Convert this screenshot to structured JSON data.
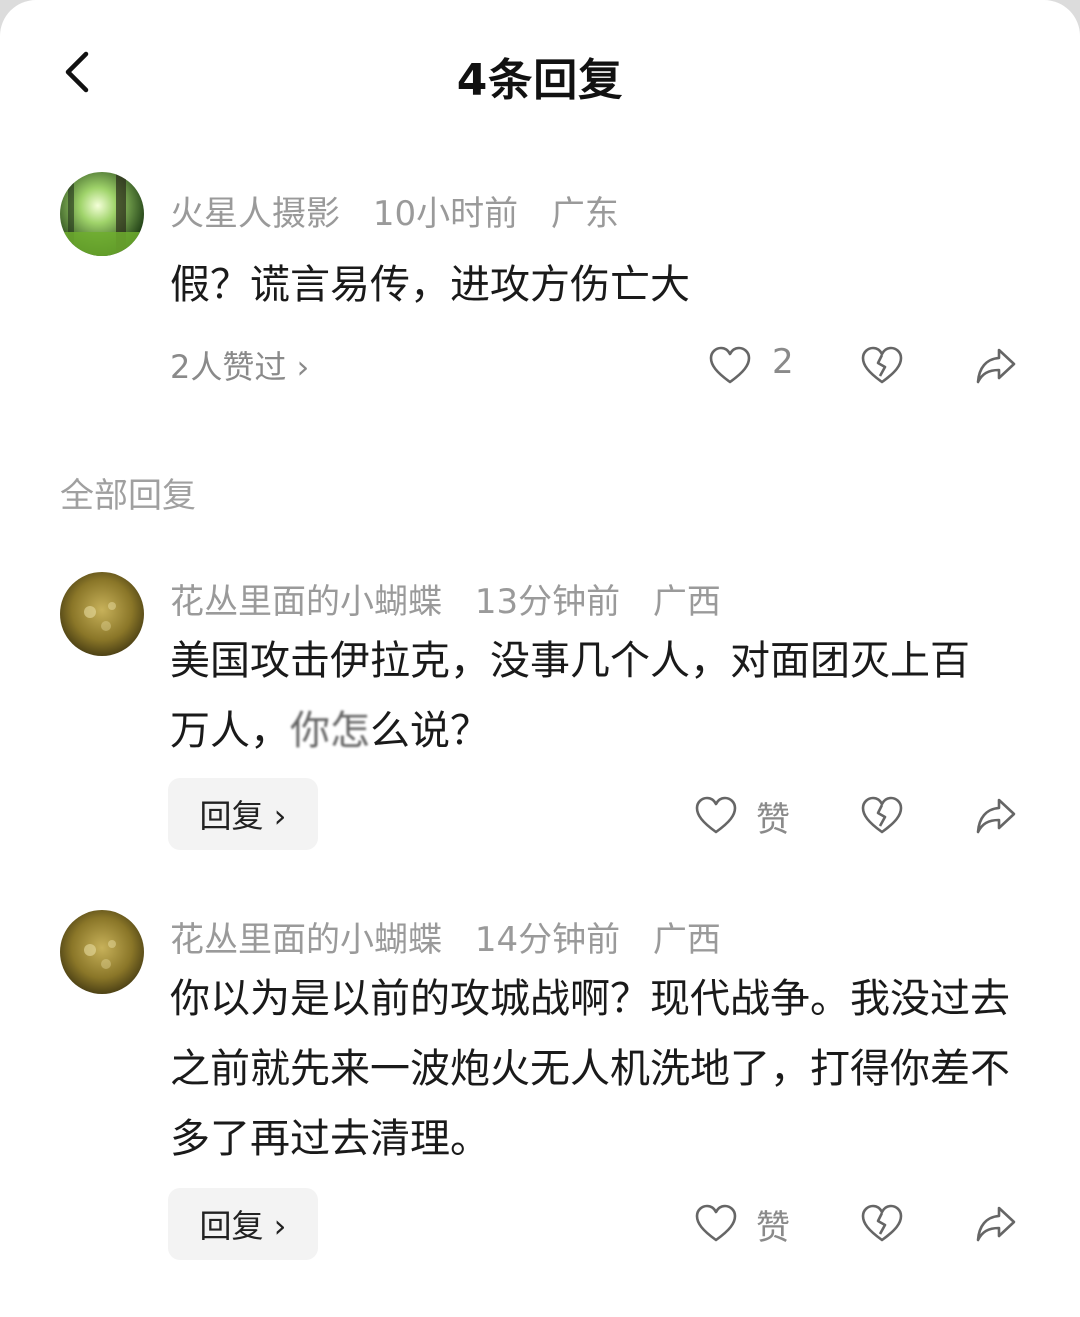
{
  "header": {
    "title": "4条回复"
  },
  "main_comment": {
    "user": "火星人摄影",
    "time": "10小时前",
    "location": "广东",
    "text": "假？谎言易传，进攻方伤亡大",
    "likes_summary": "2人赞过 ›",
    "like_count": "2"
  },
  "section_label": "全部回复",
  "replies": [
    {
      "user": "花丛里面的小蝴蝶",
      "time": "13分钟前",
      "location": "广西",
      "text_before_blur": "美国攻击伊拉克，没事几个人，对面团灭上百万人，",
      "text_blur": "你怎",
      "text_after_blur": "么说？",
      "reply_label": "回复 ›",
      "like_label": "赞"
    },
    {
      "user": "花丛里面的小蝴蝶",
      "time": "14分钟前",
      "location": "广西",
      "text": "你以为是以前的攻城战啊？现代战争。我没过去之前就先来一波炮火无人机洗地了，打得你差不多了再过去清理。",
      "reply_label": "回复 ›",
      "like_label": "赞"
    }
  ],
  "icons": {
    "back": "chevron-left-icon",
    "like": "heart-outline-icon",
    "dislike": "broken-heart-icon",
    "share": "share-arrow-icon"
  }
}
